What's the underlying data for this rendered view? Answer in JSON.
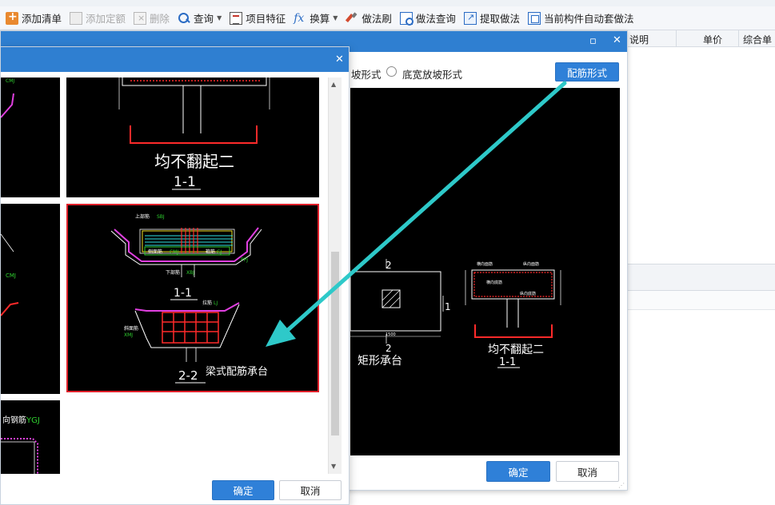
{
  "toolbar": {
    "items": [
      {
        "label": "添加清单",
        "icon": "add-list-icon",
        "enabled": true
      },
      {
        "label": "添加定额",
        "icon": "add-quota-icon",
        "enabled": false
      },
      {
        "label": "删除",
        "icon": "delete-icon",
        "enabled": false
      },
      {
        "label": "查询",
        "icon": "search-icon",
        "enabled": true,
        "has_dropdown": true
      },
      {
        "label": "项目特征",
        "icon": "feature-icon",
        "enabled": true
      },
      {
        "label": "换算",
        "icon": "fx-icon",
        "enabled": true,
        "has_dropdown": true
      },
      {
        "label": "做法刷",
        "icon": "brush-icon",
        "enabled": true
      },
      {
        "label": "做法查询",
        "icon": "method-query-icon",
        "enabled": true
      },
      {
        "label": "提取做法",
        "icon": "extract-icon",
        "enabled": true
      },
      {
        "label": "当前构件自动套做法",
        "icon": "auto-apply-icon",
        "enabled": true
      }
    ]
  },
  "table": {
    "columns": [
      "说明",
      "单价",
      "综合单"
    ]
  },
  "right_dialog": {
    "radio_partial_label": "坡形式",
    "radio_option_label": "底宽放坡形式",
    "rebar_form_button": "配筋形式",
    "ok_button": "确定",
    "cancel_button": "取消",
    "preview": {
      "caption_left": "矩形承台",
      "caption_right_title": "均不翻起二",
      "caption_right_section": "1-1",
      "dim_marker_2_top": "2",
      "dim_marker_2_bottom": "2",
      "dim_marker_1": "1",
      "dim_value": "1500",
      "rebar_labels": [
        "横向面筋",
        "纵向面筋",
        "横向底筋",
        "纵向底筋"
      ]
    }
  },
  "left_dialog": {
    "ok_button": "确定",
    "cancel_button": "取消",
    "thumbnails": {
      "top_title": "均不翻起二",
      "top_section": "1-1",
      "selected_title": "梁式配筋承台",
      "selected_section_top": "1-1",
      "selected_section_bottom": "2-2",
      "selected_labels": {
        "top_rebar": "上部筋",
        "top_rebar_code": "SBJ",
        "side_rebar": "侧面筋",
        "side_rebar_code": "CMJ",
        "hoop": "箍筋",
        "hoop_code": "GJ",
        "bottom_rebar": "下部筋",
        "bottom_rebar_code": "XBJ",
        "tie_rebar": "拉筋",
        "tie_code": "LJ",
        "slope_rebar": "斜面筋",
        "slope_code": "XMJ",
        "ppj_code": "PPJ"
      },
      "left_partial_code": "CMJ",
      "bottom_partial_label": "向钢筋",
      "bottom_partial_code": "YGJ"
    }
  },
  "colors": {
    "title_bar": "#2f7fd1",
    "primary_button": "#2f80d8",
    "selected_border": "#e0202a",
    "annotation_arrow": "#2ec9c9"
  }
}
